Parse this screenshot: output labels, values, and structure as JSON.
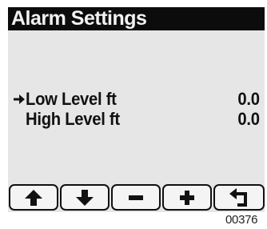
{
  "screen": {
    "title": "Alarm Settings",
    "items": [
      {
        "label": "Low Level ft",
        "value": "0.0",
        "selected": true
      },
      {
        "label": "High Level ft",
        "value": "0.0",
        "selected": false
      }
    ],
    "softkeys": [
      {
        "icon": "arrow-up-icon"
      },
      {
        "icon": "arrow-down-icon"
      },
      {
        "icon": "minus-icon"
      },
      {
        "icon": "plus-icon"
      },
      {
        "icon": "return-icon"
      }
    ]
  },
  "footer": {
    "code": "00376"
  }
}
